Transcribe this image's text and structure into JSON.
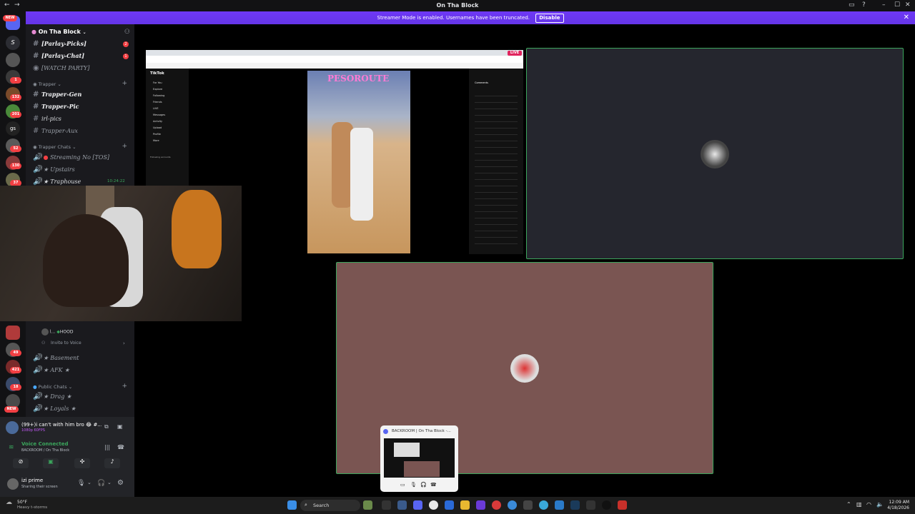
{
  "window": {
    "title": "On Tha Block"
  },
  "banner": {
    "text": "Streamer Mode is enabled. Usernames have been truncated.",
    "disable_label": "Disable"
  },
  "guild_badges": [
    {
      "label": "NEW"
    },
    {
      "label": "1"
    },
    {
      "label": "132"
    },
    {
      "label": "201"
    },
    {
      "label": "gs"
    },
    {
      "label": "52"
    },
    {
      "label": "130"
    },
    {
      "label": "37"
    },
    {
      "label": "49"
    },
    {
      "label": "421"
    },
    {
      "label": "18"
    },
    {
      "label": "NEW"
    }
  ],
  "server": {
    "name": "On Tha Block"
  },
  "channels": {
    "top": [
      {
        "name": "[Parlay-Picks]",
        "badge": "2"
      },
      {
        "name": "[Parlay-Chat]",
        "badge": "1"
      },
      {
        "name": "[WATCH PARTY]",
        "badge": ""
      }
    ],
    "trapper_category": "Trapper",
    "trapper": [
      {
        "name": "Trapper-Gen"
      },
      {
        "name": "Trapper-Pic"
      },
      {
        "name": "irl-pics"
      },
      {
        "name": "Trapper-Aux"
      }
    ],
    "trapper_chats_category": "Trapper Chats",
    "trapper_chats": [
      {
        "name": "Streaming No  [TOS]"
      },
      {
        "name": "★ Upstairs"
      },
      {
        "name": "★ Traphouse",
        "time": "10:24:22"
      }
    ],
    "voice_user": {
      "name": "l...",
      "tag": "HOOD"
    },
    "invite_label": "Invite to Voice",
    "lower": [
      {
        "name": "★ Basement"
      },
      {
        "name": "★ AFK ★"
      }
    ],
    "public_category": "Public Chats",
    "public": [
      {
        "name": "★ Drag ★"
      },
      {
        "name": "★ Loyals ★"
      }
    ]
  },
  "activity": {
    "title": "(99+)i can't with him bro 😂 #...",
    "sub": "1080p 60FPS"
  },
  "voice": {
    "status": "Voice Connected",
    "location": "BACKROOM / On Tha Block"
  },
  "user": {
    "name": "izi prime",
    "status": "Sharing their screen"
  },
  "screenshare": {
    "live_label": "LIVE",
    "tiktok_label": "TikTok",
    "video_caption": "PESOROUTE",
    "comments_tab": "Comments",
    "following_label": "Following accounts"
  },
  "tiktok_nav": [
    "For You",
    "Explore",
    "Following",
    "Friends",
    "LIVE",
    "Messages",
    "Activity",
    "Upload",
    "Profile",
    "More"
  ],
  "popup": {
    "title": "BACKROOM | On Tha Block -..."
  },
  "taskbar": {
    "weather_temp": "50°F",
    "weather_desc": "Heavy t-storms",
    "search_label": "Search",
    "time": "12:09 AM",
    "date": "4/18/2026"
  },
  "colors": {
    "accent": "#5865f2",
    "banner": "#6535e8",
    "voice_green": "#3ba55c",
    "danger": "#f23f43"
  }
}
